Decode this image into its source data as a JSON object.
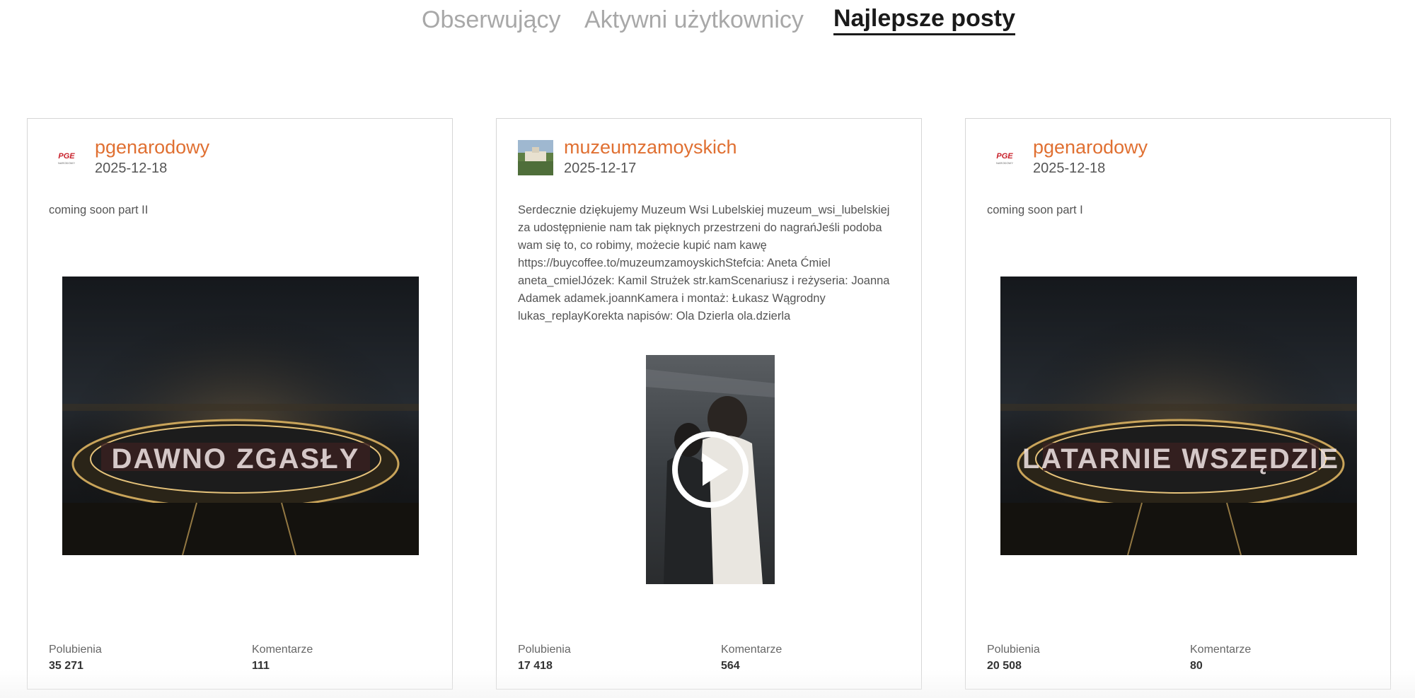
{
  "tabs": [
    {
      "label": "Obserwujący",
      "active": false
    },
    {
      "label": "Aktywni użytkownicy",
      "active": false
    },
    {
      "label": "Najlepsze posty",
      "active": true
    }
  ],
  "colors": {
    "accent": "#e07032",
    "tab_inactive": "#a8a8a8",
    "tab_active": "#1a1a1a"
  },
  "posts": [
    {
      "author": "pgenarodowy",
      "date": "2025-12-18",
      "description": "coming soon part II",
      "media_type": "image",
      "likes_label": "Polubienia",
      "likes": "35 271",
      "comments_label": "Komentarze",
      "comments": "111"
    },
    {
      "author": "muzeumzamoyskich",
      "date": "2025-12-17",
      "description": "Serdecznie dziękujemy Muzeum Wsi Lubelskiej muzeum_wsi_lubelskiej za udostępnienie nam tak pięknych przestrzeni do nagrańJeśli podoba wam się to, co robimy, możecie kupić nam kawę https://buycoffee.to/muzeumzamoyskichStefcia: Aneta Ćmiel aneta_cmielJózek: Kamil Strużek str.kamScenariusz i reżyseria: Joanna Adamek adamek.joannKamera i montaż: Łukasz Wągrodny lukas_replayKorekta napisów: Ola Dzierla ola.dzierla",
      "media_type": "video",
      "likes_label": "Polubienia",
      "likes": "17 418",
      "comments_label": "Komentarze",
      "comments": "564"
    },
    {
      "author": "pgenarodowy",
      "date": "2025-12-18",
      "description": "coming soon part I",
      "media_type": "image",
      "likes_label": "Polubienia",
      "likes": "20 508",
      "comments_label": "Komentarze",
      "comments": "80"
    }
  ]
}
